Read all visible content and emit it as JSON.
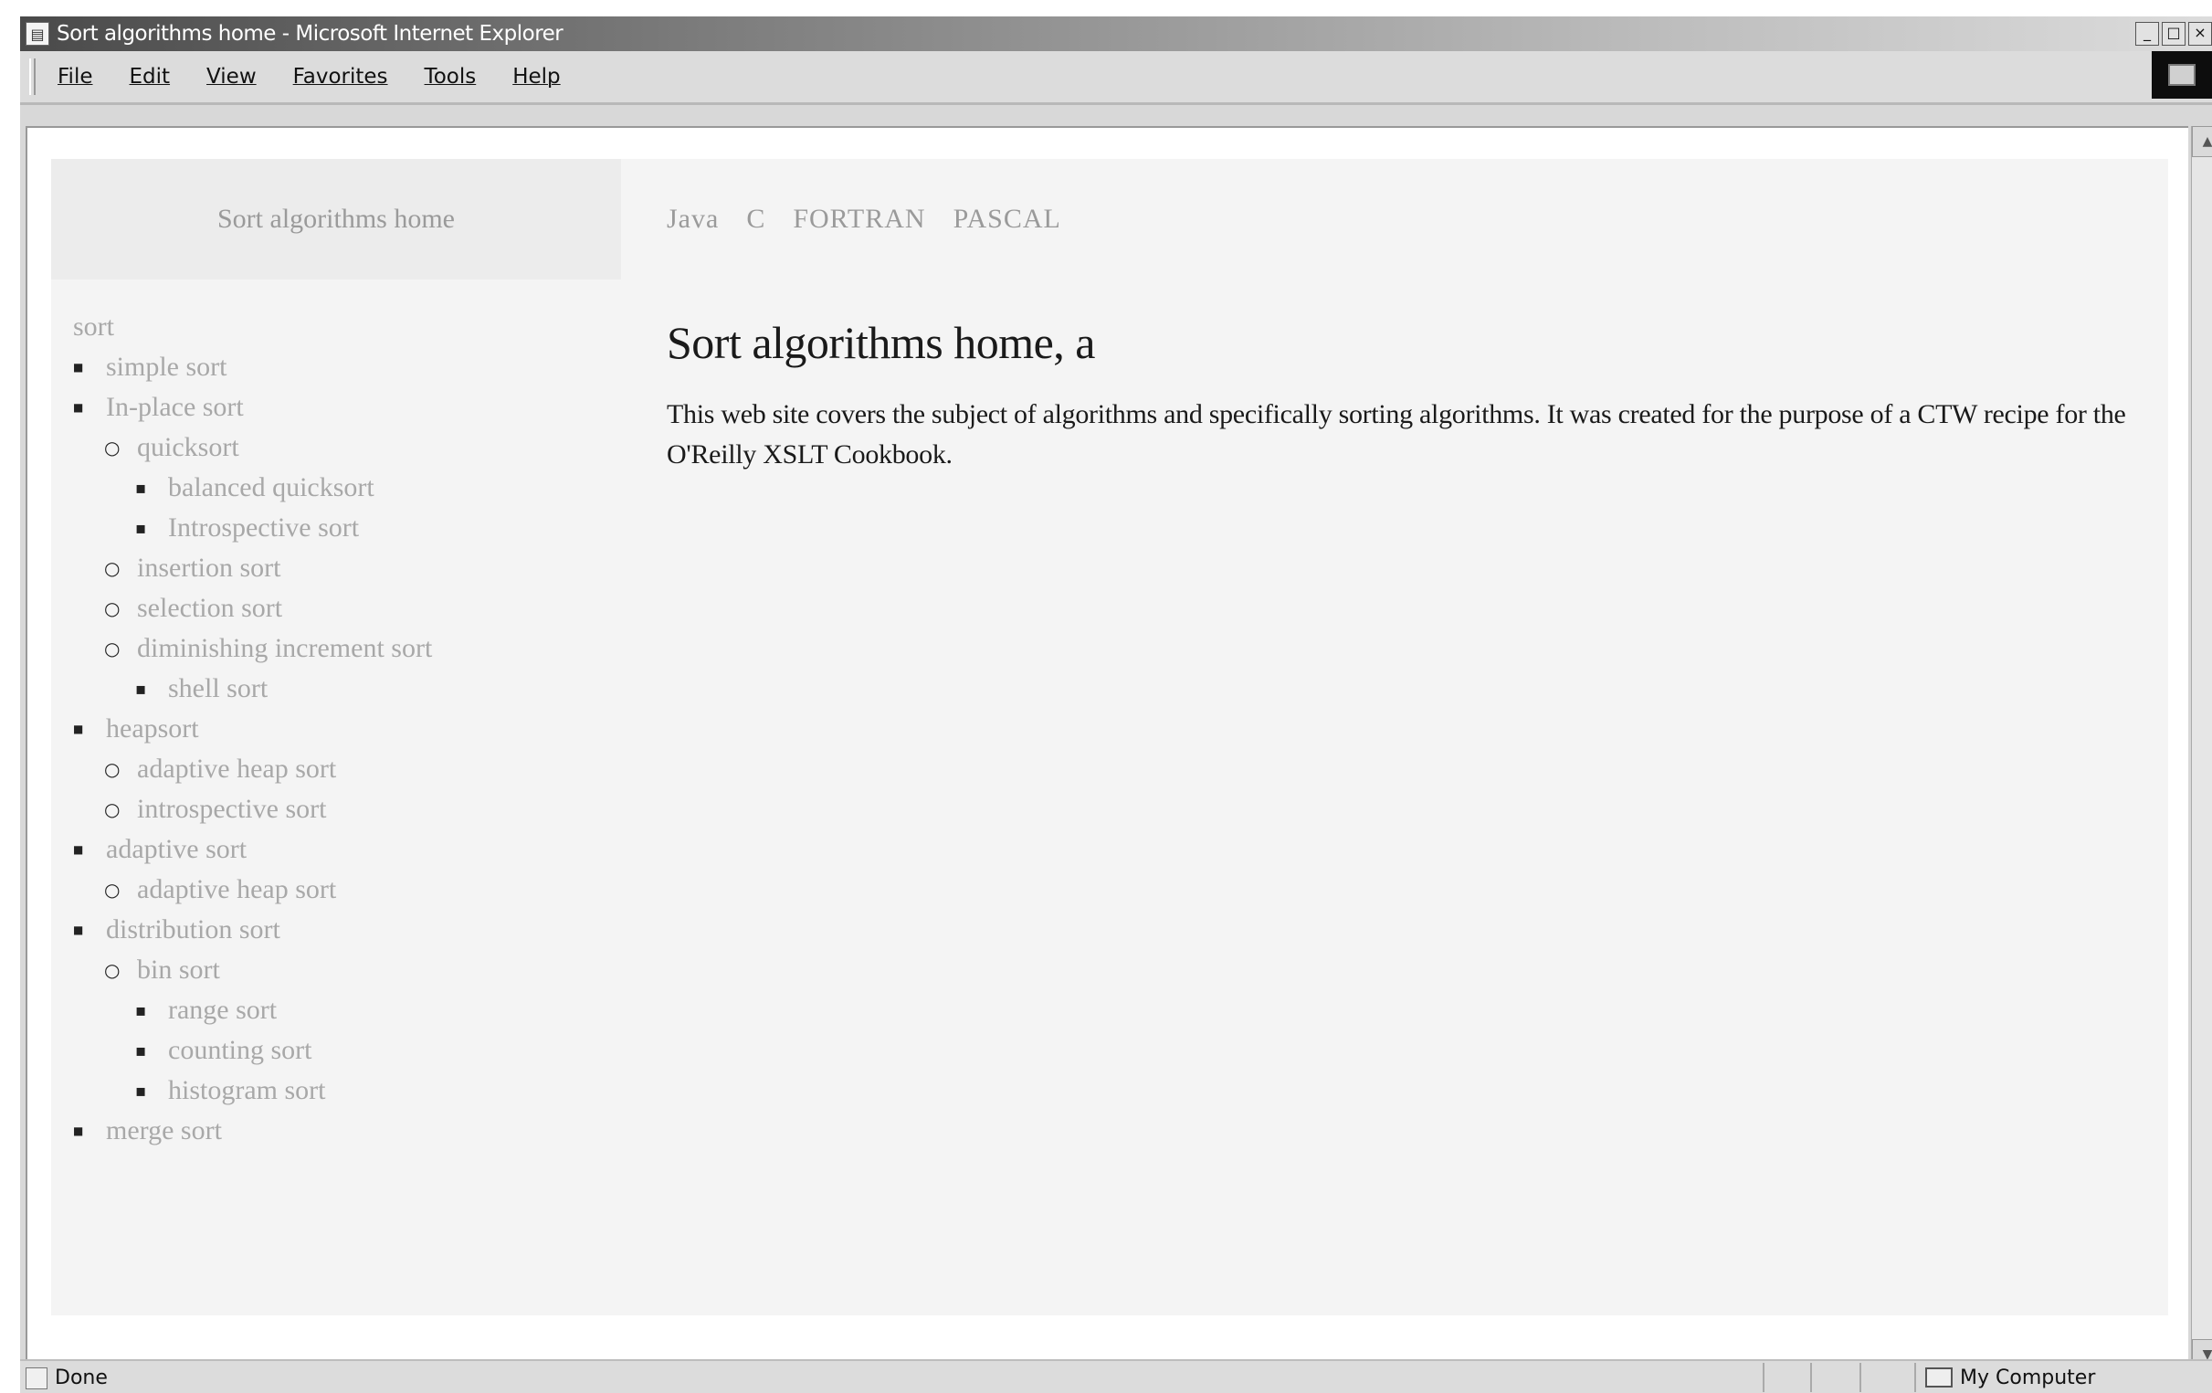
{
  "window": {
    "title": "Sort algorithms home - Microsoft Internet Explorer",
    "controls": {
      "minimize": "_",
      "maximize": "□",
      "close": "×"
    }
  },
  "menu": [
    "File",
    "Edit",
    "View",
    "Favorites",
    "Tools",
    "Help"
  ],
  "header": {
    "site_title": "Sort algorithms home",
    "nav": [
      "Java",
      "C",
      "FORTRAN",
      "PASCAL"
    ]
  },
  "sidebar": {
    "root": "sort",
    "items": [
      {
        "label": "simple sort",
        "level": 0
      },
      {
        "label": "In-place sort",
        "level": 0
      },
      {
        "label": "quicksort",
        "level": 1
      },
      {
        "label": "balanced quicksort",
        "level": 2
      },
      {
        "label": "Introspective sort",
        "level": 2
      },
      {
        "label": "insertion sort",
        "level": 1
      },
      {
        "label": "selection sort",
        "level": 1
      },
      {
        "label": "diminishing increment sort",
        "level": 1
      },
      {
        "label": "shell sort",
        "level": 2
      },
      {
        "label": "heapsort",
        "level": 0
      },
      {
        "label": "adaptive heap sort",
        "level": 1
      },
      {
        "label": "introspective sort",
        "level": 1
      },
      {
        "label": "adaptive sort",
        "level": 0
      },
      {
        "label": "adaptive heap sort",
        "level": 1
      },
      {
        "label": "distribution sort",
        "level": 0
      },
      {
        "label": "bin sort",
        "level": 1
      },
      {
        "label": "range sort",
        "level": 2
      },
      {
        "label": "counting sort",
        "level": 2
      },
      {
        "label": "histogram sort",
        "level": 2
      },
      {
        "label": "merge sort",
        "level": 0
      }
    ]
  },
  "main": {
    "heading": "Sort algorithms home, a",
    "body": "This web site covers the subject of algorithms and specifically sorting algorithms. It was created for the purpose of a CTW recipe for the O'Reilly XSLT Cookbook."
  },
  "status": {
    "text": "Done",
    "zone": "My Computer"
  }
}
